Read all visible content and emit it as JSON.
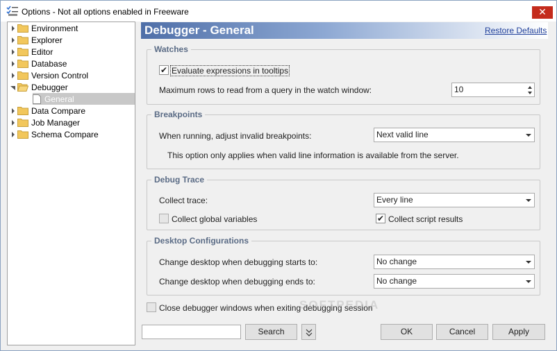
{
  "window": {
    "title": "Options - Not all options enabled in Freeware",
    "close_glyph": "✕"
  },
  "tree": {
    "items": [
      {
        "label": "Environment",
        "expanded": false
      },
      {
        "label": "Explorer",
        "expanded": false
      },
      {
        "label": "Editor",
        "expanded": false
      },
      {
        "label": "Database",
        "expanded": false
      },
      {
        "label": "Version Control",
        "expanded": false
      },
      {
        "label": "Debugger",
        "expanded": true
      },
      {
        "label": "General",
        "child": true,
        "selected": true
      },
      {
        "label": "Data Compare",
        "expanded": false
      },
      {
        "label": "Job Manager",
        "expanded": false
      },
      {
        "label": "Schema Compare",
        "expanded": false
      }
    ]
  },
  "header": {
    "title": "Debugger - General",
    "restore_label": "Restore Defaults"
  },
  "watches": {
    "label": "Watches",
    "eval_tooltips_label": "Evaluate expressions in tooltips",
    "eval_tooltips_checked": true,
    "max_rows_label": "Maximum rows to read from a query in the watch window:",
    "max_rows_value": "10"
  },
  "breakpoints": {
    "label": "Breakpoints",
    "adjust_label": "When running, adjust invalid breakpoints:",
    "adjust_value": "Next valid line",
    "note": "This option only applies when valid line information is available from the server."
  },
  "debug_trace": {
    "label": "Debug Trace",
    "collect_label": "Collect trace:",
    "collect_value": "Every line",
    "global_vars_label": "Collect global variables",
    "global_vars_checked": false,
    "script_results_label": "Collect script results",
    "script_results_checked": true
  },
  "desktop": {
    "label": "Desktop Configurations",
    "starts_label": "Change desktop when debugging starts to:",
    "starts_value": "No change",
    "ends_label": "Change desktop when debugging ends to:",
    "ends_value": "No change"
  },
  "close_windows": {
    "label": "Close debugger windows when exiting debugging session",
    "checked": false
  },
  "footer": {
    "search_value": "",
    "search_label": "Search",
    "ok_label": "OK",
    "cancel_label": "Cancel",
    "apply_label": "Apply"
  },
  "watermark": "SOFTPEDIA",
  "check_glyph": "✔",
  "colors": {
    "header_start": "#4f6fa8",
    "link": "#1f3f9a",
    "group_label": "#5a6b85",
    "close": "#c42b1c"
  }
}
